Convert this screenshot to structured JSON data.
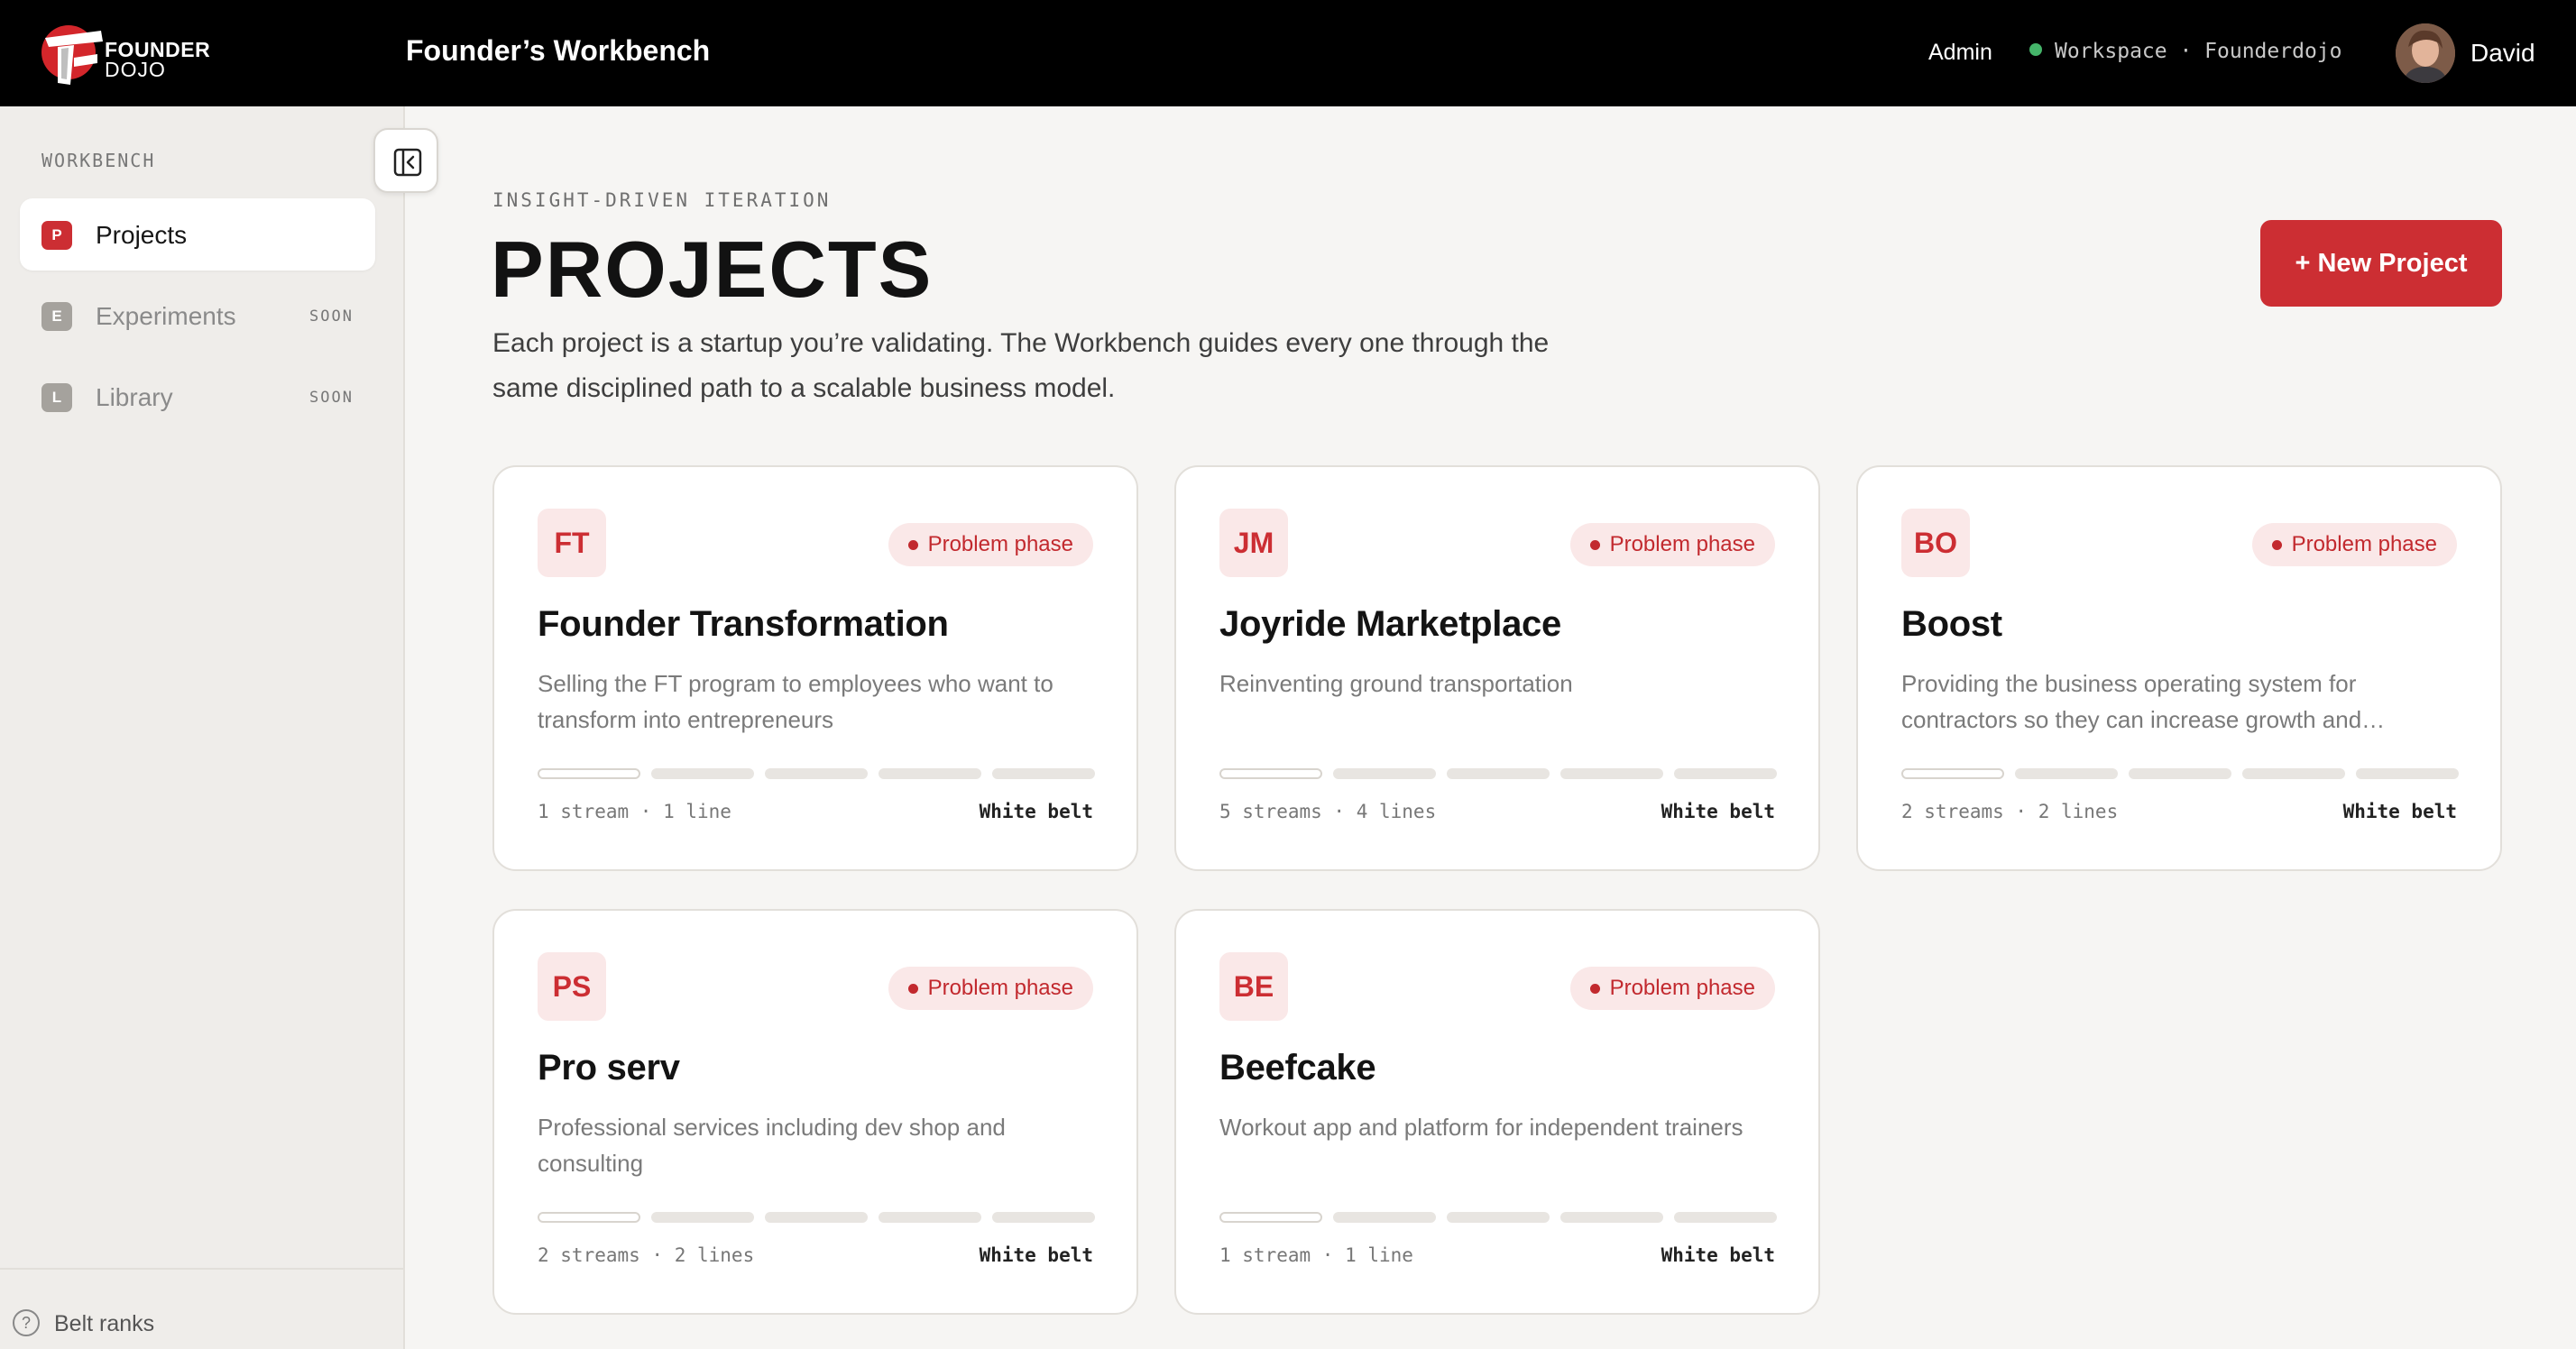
{
  "header": {
    "logo_line1": "FOUNDER",
    "logo_line2": "DOJO",
    "app_title": "Founder’s Workbench",
    "admin_label": "Admin",
    "workspace_label": "Workspace · Founderdojo",
    "workspace_status_color": "#45b56a",
    "user_name": "David"
  },
  "sidebar": {
    "heading": "WORKBENCH",
    "items": [
      {
        "badge": "P",
        "label": "Projects",
        "soon": "",
        "active": true
      },
      {
        "badge": "E",
        "label": "Experiments",
        "soon": "SOON",
        "active": false
      },
      {
        "badge": "L",
        "label": "Library",
        "soon": "SOON",
        "active": false
      }
    ],
    "footer_label": "Belt ranks",
    "help_icon_glyph": "?"
  },
  "main": {
    "kicker": "INSIGHT-DRIVEN ITERATION",
    "title": "PROJECTS",
    "description": "Each project is a startup you’re validating. The Workbench guides every one through the same disciplined path to a scalable business model.",
    "new_button_label": "+ New Project"
  },
  "accent_color": "#cc2e33",
  "projects": [
    {
      "abbr": "FT",
      "phase": "Problem phase",
      "name": "Founder Transformation",
      "desc": "Selling the FT program to employees who want to transform into entrepreneurs",
      "meta": "1 stream · 1 line",
      "belt": "White belt",
      "progress_segments": 5,
      "progress_completed": 0
    },
    {
      "abbr": "JM",
      "phase": "Problem phase",
      "name": "Joyride Marketplace",
      "desc": "Reinventing ground transportation",
      "meta": "5 streams · 4 lines",
      "belt": "White belt",
      "progress_segments": 5,
      "progress_completed": 0
    },
    {
      "abbr": "BO",
      "phase": "Problem phase",
      "name": "Boost",
      "desc": "Providing the business operating system for contractors so they can increase growth and…",
      "meta": "2 streams · 2 lines",
      "belt": "White belt",
      "progress_segments": 5,
      "progress_completed": 0
    },
    {
      "abbr": "PS",
      "phase": "Problem phase",
      "name": "Pro serv",
      "desc": "Professional services including dev shop and consulting",
      "meta": "2 streams · 2 lines",
      "belt": "White belt",
      "progress_segments": 5,
      "progress_completed": 0
    },
    {
      "abbr": "BE",
      "phase": "Problem phase",
      "name": "Beefcake",
      "desc": "Workout app and platform for independent trainers",
      "meta": "1 stream · 1 line",
      "belt": "White belt",
      "progress_segments": 5,
      "progress_completed": 0
    }
  ]
}
